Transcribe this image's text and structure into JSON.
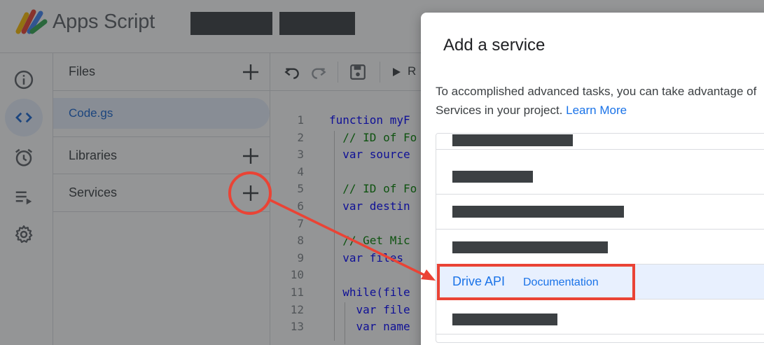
{
  "app": {
    "title": "Apps Script",
    "logo_icon": "apps-script-logo"
  },
  "rail": {
    "items": [
      {
        "name": "overview",
        "icon": "info-icon"
      },
      {
        "name": "editor",
        "icon": "code-icon",
        "active": true
      },
      {
        "name": "triggers",
        "icon": "alarm-icon"
      },
      {
        "name": "executions",
        "icon": "executions-icon"
      },
      {
        "name": "settings",
        "icon": "gear-icon"
      }
    ]
  },
  "files_panel": {
    "files_label": "Files",
    "files": [
      "Code.gs"
    ],
    "libraries_label": "Libraries",
    "services_label": "Services"
  },
  "editor": {
    "run_label": "R",
    "lines": [
      {
        "n": "1",
        "text": "function myF"
      },
      {
        "n": "2",
        "text": "  // ID of Fo"
      },
      {
        "n": "3",
        "text": "  var source"
      },
      {
        "n": "4",
        "text": ""
      },
      {
        "n": "5",
        "text": "  // ID of Fo"
      },
      {
        "n": "6",
        "text": "  var destin"
      },
      {
        "n": "7",
        "text": ""
      },
      {
        "n": "8",
        "text": "  // Get Mic"
      },
      {
        "n": "9",
        "text": "  var files"
      },
      {
        "n": "10",
        "text": ""
      },
      {
        "n": "11",
        "text": "  while(file"
      },
      {
        "n": "12",
        "text": "    var file"
      },
      {
        "n": "13",
        "text": "    var name"
      }
    ]
  },
  "dialog": {
    "title": "Add a service",
    "description_line1": "To accomplished advanced tasks, you can take advantage of",
    "description_line2": "Services in your project.",
    "learn_more": "Learn More",
    "selected_service": "Drive API",
    "documentation_label": "Documentation"
  },
  "colors": {
    "accent": "#1a73e8",
    "selected_bg": "#e8f0fe",
    "annotation": "#ea4335"
  }
}
